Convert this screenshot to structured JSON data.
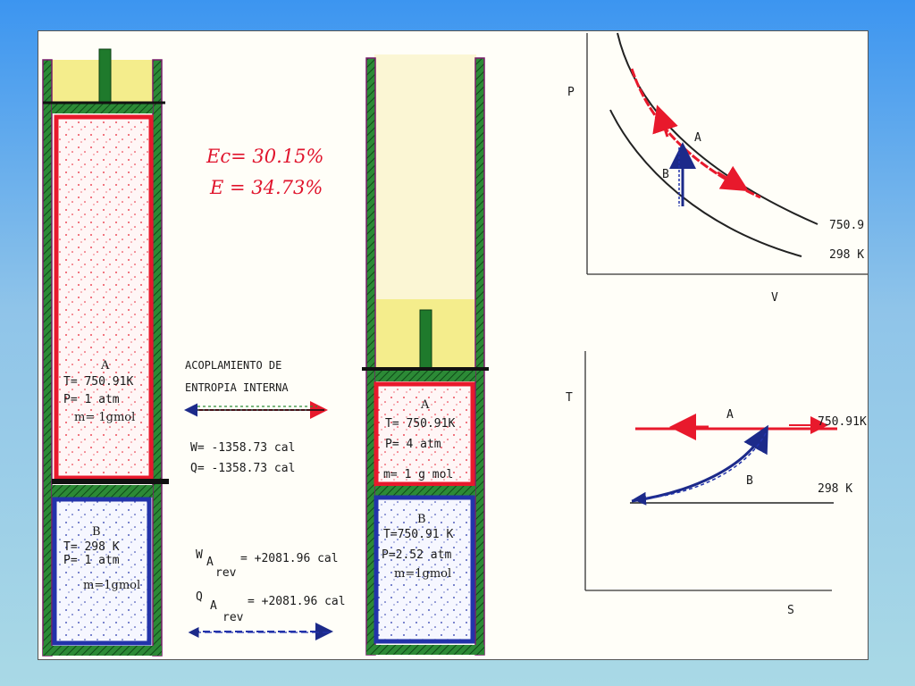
{
  "efficiency": {
    "carnot": "Ec= 30.15%",
    "actual": "E = 34.73%"
  },
  "left_cylinder": {
    "gas_a": {
      "label": "A",
      "temperature": "T= 750.91K",
      "pressure": "P= 1 atm",
      "mass": "m= 1gmol"
    },
    "gas_b": {
      "label": "B",
      "temperature": "T= 298 K",
      "pressure": "P= 1 atm",
      "mass": "m=1gmol"
    }
  },
  "coupling": {
    "title_line1": "ACOPLAMIENTO DE",
    "title_line2": "ENTROPIA INTERNA",
    "work": "W= -1358.73 cal",
    "heat": "Q= -1358.73 cal",
    "w_rev_symbol": "W",
    "w_rev_sub": "A",
    "w_rev_sub2": "rev",
    "w_rev_value": "= +2081.96 cal",
    "q_rev_symbol": "Q",
    "q_rev_sub": "A",
    "q_rev_sub2": "rev",
    "q_rev_value": "= +2081.96 cal"
  },
  "right_cylinder": {
    "gas_a": {
      "label": "A",
      "temperature": "T= 750.91K",
      "pressure": "P= 4 atm",
      "mass": "m= 1 g mol"
    },
    "gas_b": {
      "label": "B",
      "temperature": "T=750.91 K",
      "pressure": "P=2.52 atm",
      "mass": "m=1gmol"
    }
  },
  "pv_diagram": {
    "y_axis": "P",
    "x_axis": "V",
    "isotherm_hot": "750.9",
    "isotherm_cold": "298 K",
    "point_a": "A",
    "point_b": "B"
  },
  "ts_diagram": {
    "y_axis": "T",
    "x_axis": "S",
    "line_hot": "750.91K",
    "line_cold": "298 K",
    "label_a": "A",
    "label_b": "B"
  },
  "colors": {
    "gas_a": "#e8192c",
    "gas_b": "#2233aa",
    "wall": "#1f7a2c",
    "piston_fill": "#f3ec86"
  }
}
